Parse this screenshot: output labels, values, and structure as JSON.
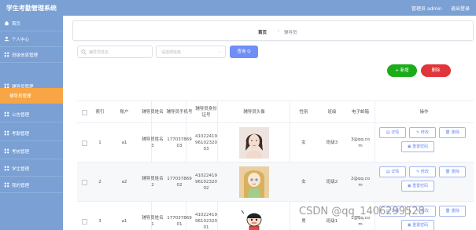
{
  "app": {
    "title": "学生考勤管理系统",
    "admin_label": "管理员 admin",
    "logout_label": "退出登录"
  },
  "sidebar": {
    "items": [
      {
        "label": "首页",
        "icon": "home-icon"
      },
      {
        "label": "个人中心",
        "icon": "user-icon"
      },
      {
        "label": "班级信息管理",
        "icon": "grid-icon"
      },
      {
        "label": "辅导员管理",
        "icon": "grid-icon"
      },
      {
        "label": "辅导员管理",
        "icon": "",
        "active": true
      },
      {
        "label": "公告管理",
        "icon": "grid-icon"
      },
      {
        "label": "考勤管理",
        "icon": "grid-icon"
      },
      {
        "label": "考核管理",
        "icon": "grid-icon"
      },
      {
        "label": "学生管理",
        "icon": "grid-icon"
      },
      {
        "label": "我的管理",
        "icon": "grid-icon"
      }
    ]
  },
  "breadcrumb": {
    "home": "首页",
    "separator": "/",
    "current": "辅导员"
  },
  "search": {
    "name_placeholder": "辅导员姓名",
    "class_placeholder": "请选择班级",
    "query_label": "查询 Q"
  },
  "actions": {
    "add_label": "+ 新增",
    "delete_label": "删除"
  },
  "table": {
    "headers": [
      "索引",
      "账户",
      "辅导员姓名",
      "辅导员手机号",
      "辅导员身份证号",
      "辅导员头像",
      "性别",
      "班级",
      "电子邮箱",
      "操作"
    ],
    "rows": [
      {
        "index": "1",
        "account": "a1",
        "name": "辅导员姓名3",
        "phone": "17703786903",
        "id_number": "410224199610232003",
        "gender": "女",
        "class": "班级3",
        "email": "3@qq.com"
      },
      {
        "index": "2",
        "account": "a2",
        "name": "辅导员姓名2",
        "phone": "17703786902",
        "id_number": "410224199610232002",
        "gender": "女",
        "class": "班级2",
        "email": "2@qq.com"
      },
      {
        "index": "3",
        "account": "a1",
        "name": "辅导员姓名1",
        "phone": "17703786901",
        "id_number": "410224199610232001",
        "gender": "男",
        "class": "班级1",
        "email": "1@qq.com"
      }
    ],
    "op_labels": {
      "detail": "详情",
      "edit": "修改",
      "delete": "删除",
      "reset": "重置密码"
    }
  },
  "watermark": "CSDN @qq_1406299528",
  "colors": {
    "sidebar": "#7aa0d4",
    "active": "#f7a545",
    "primary": "#6f8ef6",
    "add": "#1aad19",
    "delete": "#e0353a"
  }
}
